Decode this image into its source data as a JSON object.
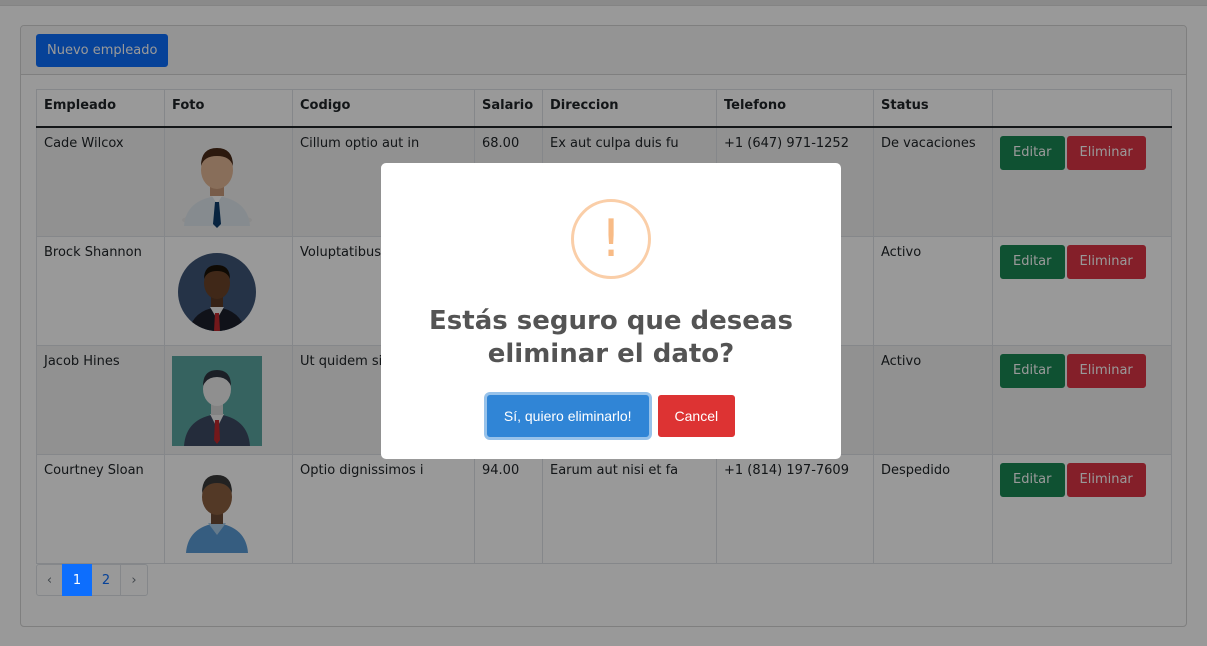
{
  "toolbar": {
    "new_label": "Nuevo empleado"
  },
  "table": {
    "headers": [
      "Empleado",
      "Foto",
      "Codigo",
      "Salario",
      "Direccion",
      "Telefono",
      "Status",
      ""
    ],
    "rows": [
      {
        "empleado": "Cade Wilcox",
        "codigo": "Cillum optio aut in",
        "salario": "68.00",
        "direccion": "Ex aut culpa duis fu",
        "telefono": "+1 (647) 971-1252",
        "status": "De vacaciones",
        "edit": "Editar",
        "delete": "Eliminar",
        "photo_icon": "avatar-businessman-light"
      },
      {
        "empleado": "Brock Shannon",
        "codigo": "Voluptatibus c",
        "salario": "",
        "direccion": "",
        "telefono": "",
        "status": "Activo",
        "edit": "Editar",
        "delete": "Eliminar",
        "photo_icon": "avatar-businessman-round"
      },
      {
        "empleado": "Jacob Hines",
        "codigo": "Ut quidem sit",
        "salario": "",
        "direccion": "",
        "telefono": "",
        "status": "Activo",
        "edit": "Editar",
        "delete": "Eliminar",
        "photo_icon": "avatar-businessman-teal"
      },
      {
        "empleado": "Courtney Sloan",
        "codigo": "Optio dignissimos i",
        "salario": "94.00",
        "direccion": "Earum aut nisi et fa",
        "telefono": "+1 (814) 197-7609",
        "status": "Despedido",
        "edit": "Editar",
        "delete": "Eliminar",
        "photo_icon": "avatar-man-blue-shirt"
      }
    ]
  },
  "pagination": {
    "prev": "‹",
    "pages": [
      "1",
      "2"
    ],
    "next": "›",
    "current": "1"
  },
  "dialog": {
    "icon": "!",
    "title": "Estás seguro que deseas eliminar el dato?",
    "confirm_label": "Sí, quiero eliminarlo!",
    "cancel_label": "Cancel"
  },
  "colors": {
    "primary": "#0d6efd",
    "success": "#198754",
    "danger": "#dc3545",
    "confirm": "#3085d6",
    "cancel": "#dd3333",
    "warning": "#f8bb86"
  }
}
